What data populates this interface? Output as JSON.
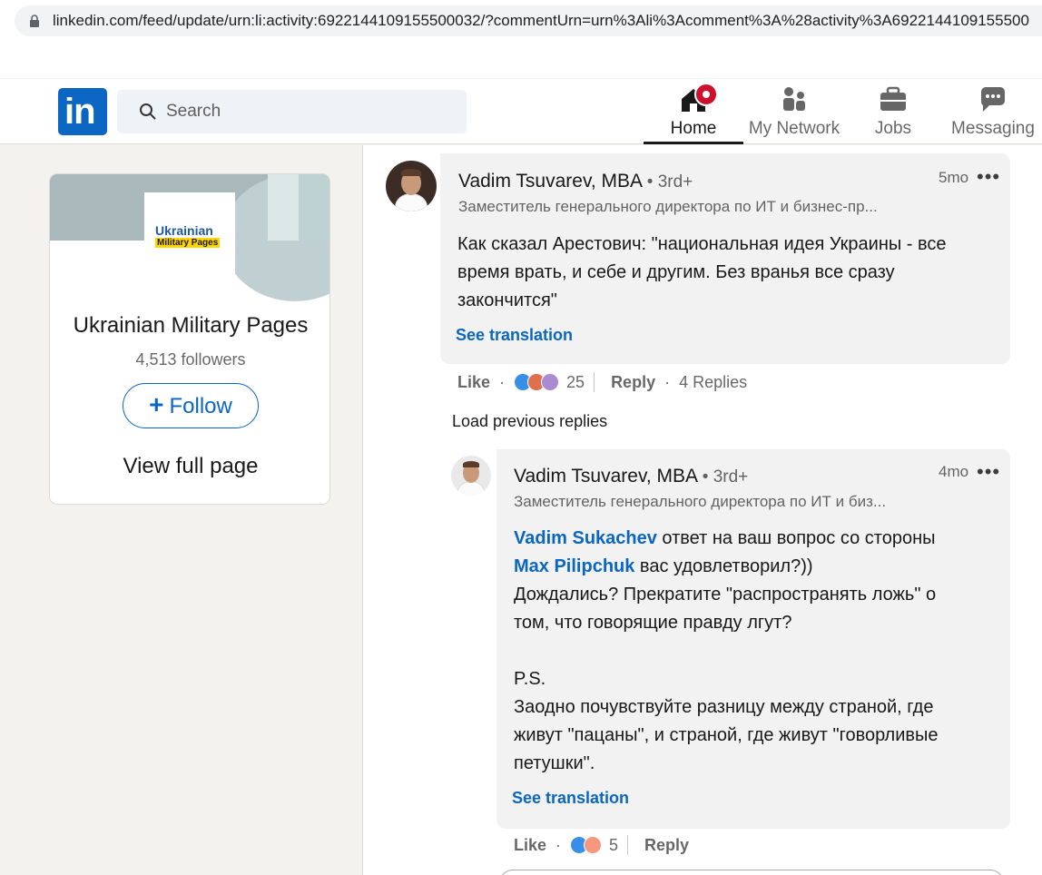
{
  "browser": {
    "url": "linkedin.com/feed/update/urn:li:activity:6922144109155500032/?commentUrn=urn%3Ali%3Acomment%3A%28activity%3A6922144109155500"
  },
  "nav": {
    "logo_text": "in",
    "search_placeholder": "Search",
    "items": [
      {
        "label": "Home",
        "icon": "home-icon",
        "active": true
      },
      {
        "label": "My Network",
        "icon": "network-icon"
      },
      {
        "label": "Jobs",
        "icon": "briefcase-icon"
      },
      {
        "label": "Messaging",
        "icon": "messaging-icon"
      }
    ],
    "accent": "#0a66c2",
    "badge_color": "#cb112d"
  },
  "org_card": {
    "logo_line1": "Ukrainian",
    "logo_line2": "Military Pages",
    "name": "Ukrainian Military Pages",
    "followers": "4,513 followers",
    "follow_label": "Follow",
    "view_full_label": "View full page"
  },
  "comments": [
    {
      "author": "Vadim Tsuvarev, MBA",
      "degree": "• 3rd+",
      "headline": "Заместитель генерального директора по ИТ и бизнес-пр...",
      "time": "5mo",
      "text_lines": [
        "Как сказал Арестович: \"национальная идея Украины - все",
        "время врать, и себе и другим. Без вранья все сразу",
        "закончится\""
      ],
      "see_translation": "See translation",
      "like_label": "Like",
      "reaction_count": "25",
      "reply_label": "Reply",
      "replies_count": "4 Replies"
    },
    {
      "author": "Vadim Tsuvarev, MBA",
      "degree": "• 3rd+",
      "headline": "Заместитель генерального директора по ИТ и биз...",
      "time": "4mo",
      "mention1": "Vadim Sukachev",
      "text1": " ответ на ваш вопрос со стороны",
      "mention2": "Max Pilipchuk",
      "text2": " вас удовлетворил?))",
      "line3": "Дождались? Прекратите \"распространять ложь\" о",
      "line4": "том, что говорящие правду лгут?",
      "line5": "P.S.",
      "line6": "Заодно почувствуйте разницу между страной, где",
      "line7": "живут \"пацаны\", и страной, где живут \"говорливые",
      "line8": "петушки\".",
      "see_translation": "See translation",
      "like_label": "Like",
      "reaction_count": "5",
      "reply_label": "Reply"
    }
  ],
  "load_previous": "Load previous replies"
}
